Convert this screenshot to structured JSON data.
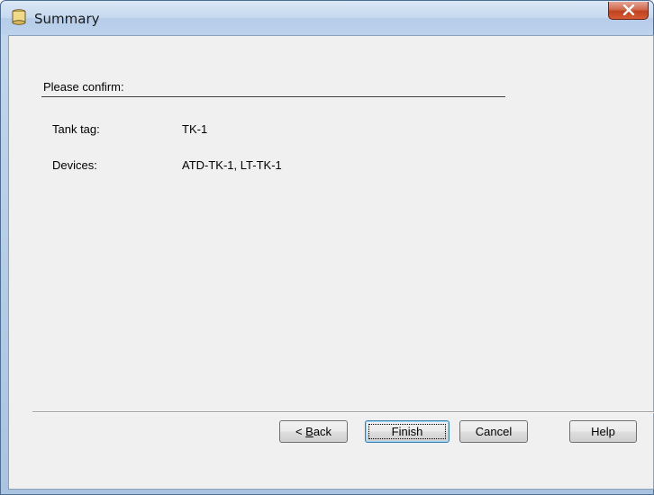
{
  "window": {
    "title": "Summary",
    "icon": "tank-icon",
    "close_icon": "close-icon"
  },
  "content": {
    "confirm_label": "Please confirm:",
    "rows": [
      {
        "label": "Tank tag:",
        "value": "TK-1"
      },
      {
        "label": "Devices:",
        "value": "ATD-TK-1, LT-TK-1"
      }
    ]
  },
  "buttons": {
    "back_prefix": "< ",
    "back_mnemonic": "B",
    "back_rest": "ack",
    "finish": "Finish",
    "cancel": "Cancel",
    "help": "Help"
  },
  "colors": {
    "titlebar": "#c6d9ef",
    "client_bg": "#f0f0f0",
    "close_button": "#c0421f"
  }
}
